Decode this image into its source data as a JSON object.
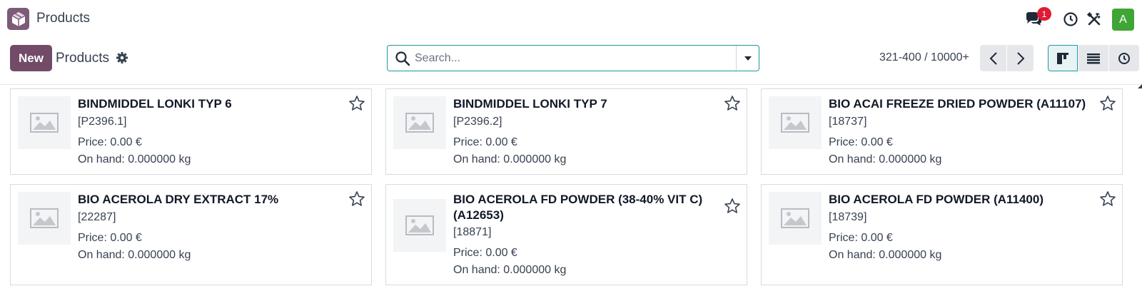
{
  "navbar": {
    "app_title": "Products",
    "messages_badge": "1",
    "avatar_letter": "A",
    "icons": [
      "app-logo-icon",
      "messages-icon",
      "clock-icon",
      "tools-icon"
    ]
  },
  "control_panel": {
    "new_label": "New",
    "breadcrumb": "Products",
    "search_placeholder": "Search...",
    "pager": "321-400 / 10000+"
  },
  "colors": {
    "brand": "#714b67",
    "accent": "#1f97a1",
    "badge": "#e01b35",
    "avatar": "#3fa535"
  },
  "products": [
    {
      "name": "BINDMIDDEL LONKI TYP 6",
      "code": "[P2396.1]",
      "price": "Price: 0.00 €",
      "on_hand": "On hand: 0.000000 kg"
    },
    {
      "name": "BINDMIDDEL LONKI TYP 7",
      "code": "[P2396.2]",
      "price": "Price: 0.00 €",
      "on_hand": "On hand: 0.000000 kg"
    },
    {
      "name": "BIO ACAI FREEZE DRIED POWDER (A11107)",
      "code": "[18737]",
      "price": "Price: 0.00 €",
      "on_hand": "On hand: 0.000000 kg"
    },
    {
      "name": "BIO ACEROLA DRY EXTRACT 17%",
      "code": "[22287]",
      "price": "Price: 0.00 €",
      "on_hand": "On hand: 0.000000 kg"
    },
    {
      "name": "BIO ACEROLA FD POWDER (38-40% VIT C) (A12653)",
      "code": "[18871]",
      "price": "Price: 0.00 €",
      "on_hand": "On hand: 0.000000 kg"
    },
    {
      "name": "BIO ACEROLA FD POWDER (A11400)",
      "code": "[18739]",
      "price": "Price: 0.00 €",
      "on_hand": "On hand: 0.000000 kg"
    }
  ]
}
